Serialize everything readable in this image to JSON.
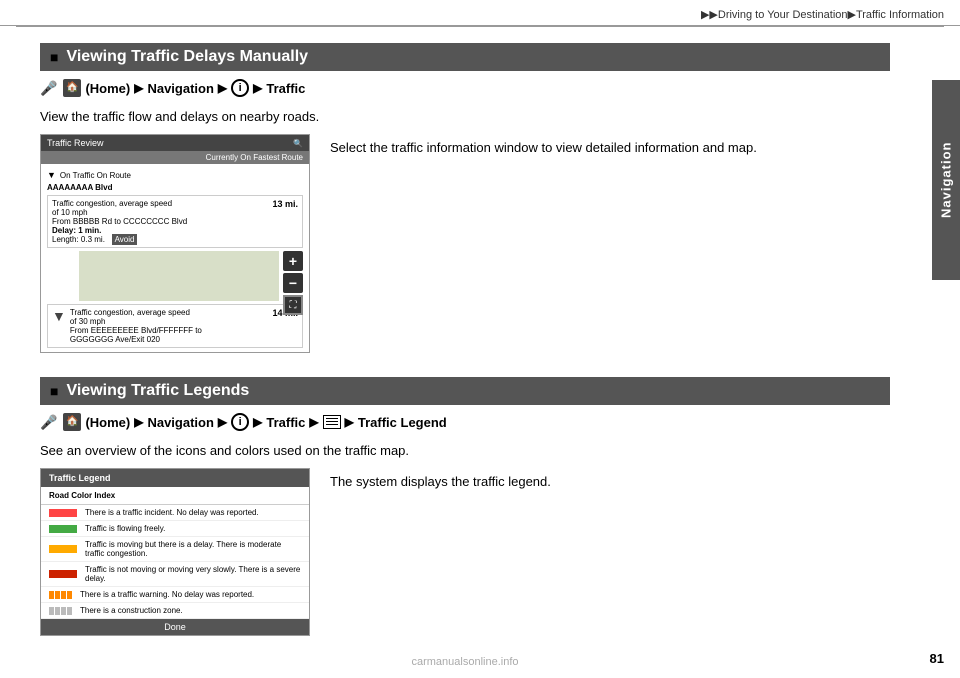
{
  "header": {
    "breadcrumb": "▶▶Driving to Your Destination▶Traffic Information"
  },
  "right_tab": {
    "label": "Navigation"
  },
  "section1": {
    "heading": "Viewing Traffic Delays Manually",
    "path_prefix": "(Home)",
    "path_parts": [
      "Navigation",
      "i",
      "Traffic"
    ],
    "description": "View the traffic flow and delays on nearby roads.",
    "desc_text": "Select the traffic information window to view detailed information and map.",
    "screen": {
      "title": "Traffic Review",
      "top_right": "Currently On Fastest Route",
      "on_route_label": "On Traffic On Route",
      "street": "AAAAAAAA Blvd",
      "item1_text": "Traffic congestion, average speed of 10 mph\nFrom BBBBB Rd to CCCCCCCC Blvd\nDelay: 1 min.\nLength: 0.3 mi.",
      "item1_action": "Avoid",
      "item1_miles": "13 mi.",
      "item2_text": "Traffic congestion, average speed of 30 mph\nFrom EEEEEEEEE Blvd/FFFFFFF to\nGGGGGGG Ave/Exit 020",
      "item2_miles": "14 mi."
    }
  },
  "section2": {
    "heading": "Viewing Traffic Legends",
    "path_prefix": "(Home)",
    "path_parts": [
      "Navigation",
      "i",
      "Traffic",
      "menu",
      "Traffic Legend"
    ],
    "description": "See an overview of the icons and colors used on the traffic map.",
    "desc_text": "The system displays the traffic legend.",
    "screen": {
      "title": "Traffic Legend",
      "subheader": "Road Color Index",
      "rows": [
        {
          "color": "#ff4444",
          "text": "There is a traffic incident. No delay was reported."
        },
        {
          "color": "#44aa44",
          "text": "Traffic is flowing freely."
        },
        {
          "color": "#ffaa00",
          "text": "Traffic is moving but there is a delay. There is moderate traffic congestion."
        },
        {
          "color": "#cc2200",
          "text": "Traffic is not moving or moving very slowly. There is a severe delay."
        },
        {
          "color": "#ff8800",
          "text": "There is a traffic warning. No delay was reported."
        },
        {
          "color": "#bbbbbb",
          "text": "There is a construction zone."
        }
      ],
      "done_label": "Done"
    }
  },
  "page_number": "81",
  "watermark": "carmanualsonline.info"
}
